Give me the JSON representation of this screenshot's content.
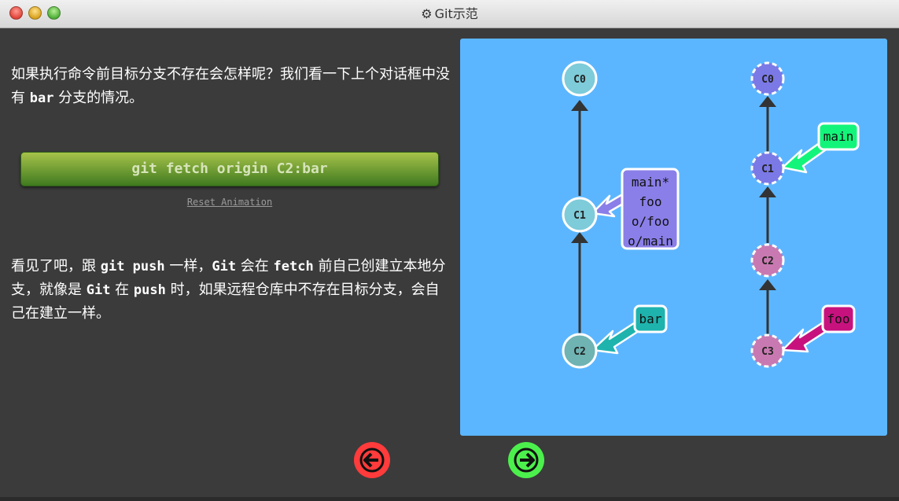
{
  "window": {
    "title": "Git示范",
    "title_icon": "gear-icon"
  },
  "left": {
    "para1": {
      "p1": "如果执行命令前目标分支不存在会怎样呢？我们看一下上个对话框中没有 ",
      "c1": "bar",
      "p2": " 分支的情况。"
    },
    "command_button": "git fetch origin C2:bar",
    "reset_link": "Reset Animation",
    "para2": {
      "p1": "看见了吧，跟 ",
      "c1": "git push",
      "p2": " 一样，",
      "c2": "Git",
      "p3": " 会在 ",
      "c3": "fetch",
      "p4": " 前自己创建立本地分支，就像是 ",
      "c4": "Git",
      "p5": " 在 ",
      "c5": "push",
      "p6": " 时，如果远程仓库中不存在目标分支，会自己在建立一样。"
    }
  },
  "viz": {
    "local": {
      "commits": [
        "C0",
        "C1",
        "C2"
      ],
      "c1_labels": [
        "main*",
        "foo",
        "o/foo",
        "o/main"
      ],
      "c2_label": "bar"
    },
    "remote": {
      "commits": [
        "C0",
        "C1",
        "C2",
        "C3"
      ],
      "c1_label": "main",
      "c3_label": "foo"
    }
  },
  "colors": {
    "viz_background": "#5cb6ff",
    "local_commit": "#7ecbd9",
    "local_c2": "#6fb3b3",
    "remote_commit": "#7b79e6",
    "remote_pink": "#c979b1",
    "branch_main_local": "#8a7fe8",
    "branch_bar": "#1fb3ad",
    "branch_main_remote": "#13f57a",
    "branch_foo": "#c7127e",
    "prev_button": "#ff3b3b",
    "next_button": "#4cf04c"
  },
  "nav": {
    "prev_icon": "arrow-left-icon",
    "next_icon": "arrow-right-icon"
  }
}
